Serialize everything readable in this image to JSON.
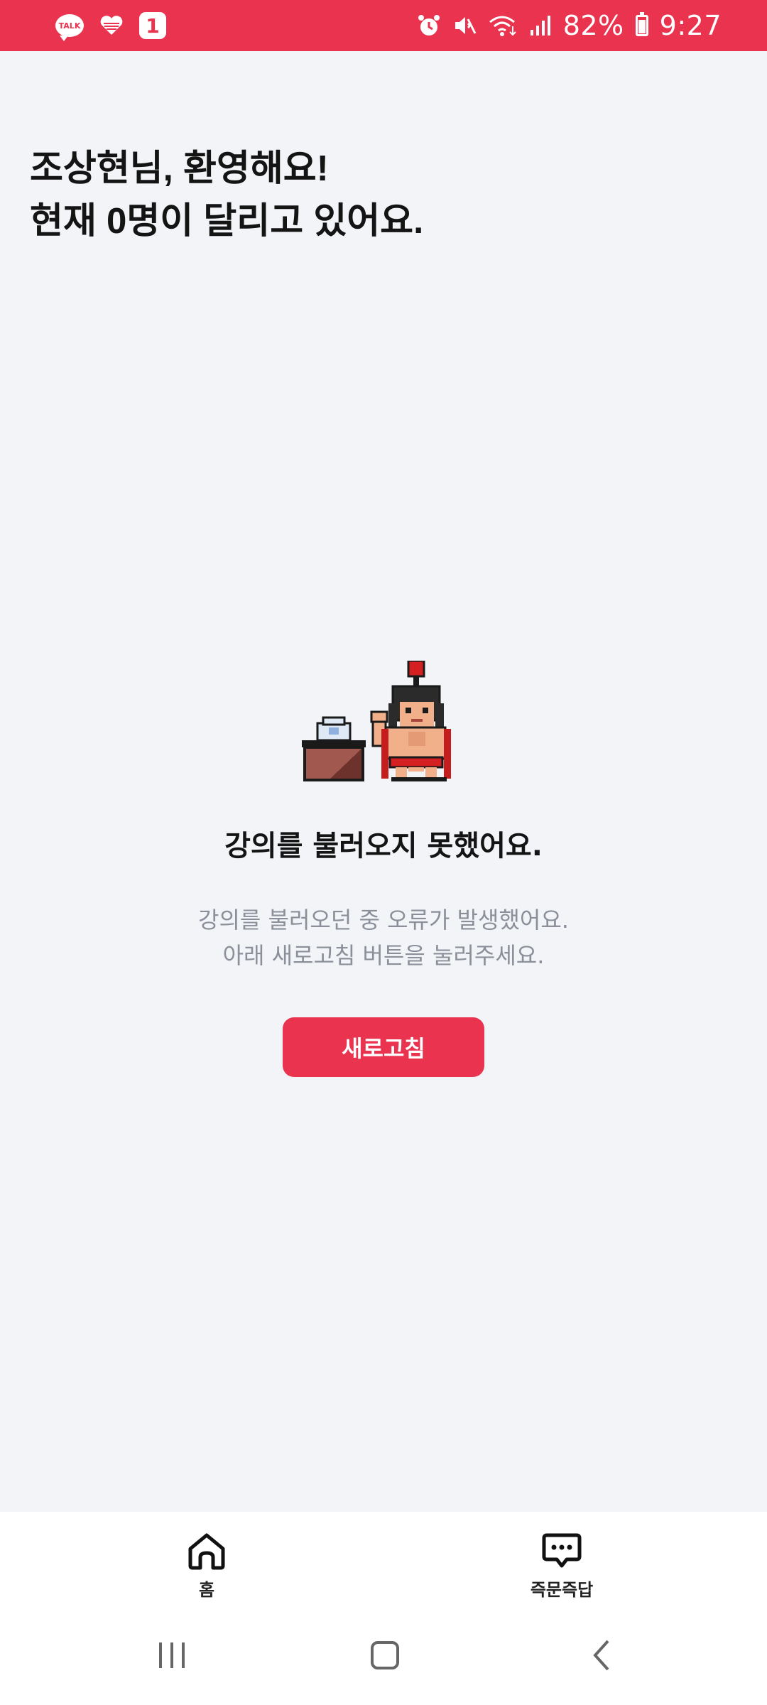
{
  "status_bar": {
    "notif_talk_label": "TALK",
    "notif_one_label": "1",
    "battery": "82%",
    "time": "9:27"
  },
  "greeting": {
    "line1": "조상현님, 환영해요!",
    "line2": "현재 0명이 달리고 있어요."
  },
  "error": {
    "title": "강의를 불러오지 못했어요.",
    "desc_line1": "강의를 불러오던 중 오류가 발생했어요.",
    "desc_line2": "아래 새로고침 버튼을 눌러주세요.",
    "refresh_label": "새로고침"
  },
  "bottom_nav": {
    "items": [
      {
        "label": "홈",
        "icon": "home-icon"
      },
      {
        "label": "즉문즉답",
        "icon": "chat-bubble-icon"
      }
    ]
  },
  "system_nav": {
    "buttons": [
      "recent-apps-icon",
      "home-circle-icon",
      "back-icon"
    ]
  },
  "colors": {
    "accent": "#e9334f",
    "background": "#f2f4f7"
  }
}
